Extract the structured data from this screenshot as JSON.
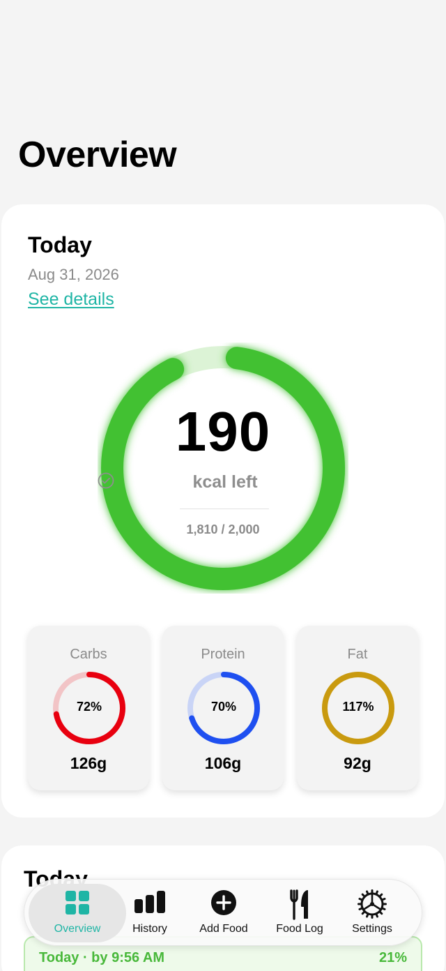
{
  "header": {
    "title": "Overview"
  },
  "summary": {
    "title": "Today",
    "date": "Aug 31, 2026",
    "details_link": "See details",
    "kcal_left": "190",
    "kcal_label": "kcal left",
    "kcal_ratio": "1,810 / 2,000",
    "kcal_consumed": 1810,
    "kcal_goal": 2000,
    "ring_color": "#43c132"
  },
  "macros": [
    {
      "name": "Carbs",
      "percent_label": "72%",
      "percent": 72,
      "grams": "126g",
      "color": "#e8000f",
      "track": "#f2c4c6"
    },
    {
      "name": "Protein",
      "percent_label": "70%",
      "percent": 70,
      "grams": "106g",
      "color": "#1e4ff0",
      "track": "#c9d4f6"
    },
    {
      "name": "Fat",
      "percent_label": "117%",
      "percent": 117,
      "grams": "92g",
      "color": "#c99a0f",
      "track": "#f0e1b0"
    }
  ],
  "second_card": {
    "title": "Today"
  },
  "progress": {
    "label": "Today · by 9:56 AM",
    "percent_label": "21%"
  },
  "tabbar": {
    "active": "Overview",
    "tabs": [
      {
        "label": "Overview",
        "icon": "grid-icon"
      },
      {
        "label": "History",
        "icon": "bar-chart-icon"
      },
      {
        "label": "Add Food",
        "icon": "plus-circle-icon"
      },
      {
        "label": "Food Log",
        "icon": "fork-knife-icon"
      },
      {
        "label": "Settings",
        "icon": "gear-icon"
      }
    ]
  },
  "colors": {
    "accent": "#1fb5a5",
    "background": "#f4f4f4"
  }
}
